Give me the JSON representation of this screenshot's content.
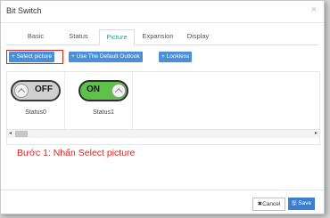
{
  "dialog": {
    "title": "Bit Switch",
    "close_icon": "×"
  },
  "tabs": [
    {
      "label": "Basic"
    },
    {
      "label": "Status"
    },
    {
      "label": "Picture",
      "active": true
    },
    {
      "label": "Expansion"
    },
    {
      "label": "Display"
    }
  ],
  "toolbar": {
    "select_picture": "+ Select picture",
    "use_default": "+ Use The Default Outlook",
    "lookless": "+ Lookless"
  },
  "statuses": [
    {
      "toggle_text": "OFF",
      "label": "Status0"
    },
    {
      "toggle_text": "ON",
      "label": "Status1"
    }
  ],
  "scroll": {
    "left": "◂",
    "right": "▸"
  },
  "instruction": "Bước 1: Nhấn Select picture",
  "footer": {
    "cancel": "✖Cancel",
    "save": "🖫 Save"
  },
  "colors": {
    "accent": "#4a8fd8",
    "active_tab": "#21a38f",
    "highlight": "#e02020",
    "toggle_on": "#5dc14a"
  }
}
